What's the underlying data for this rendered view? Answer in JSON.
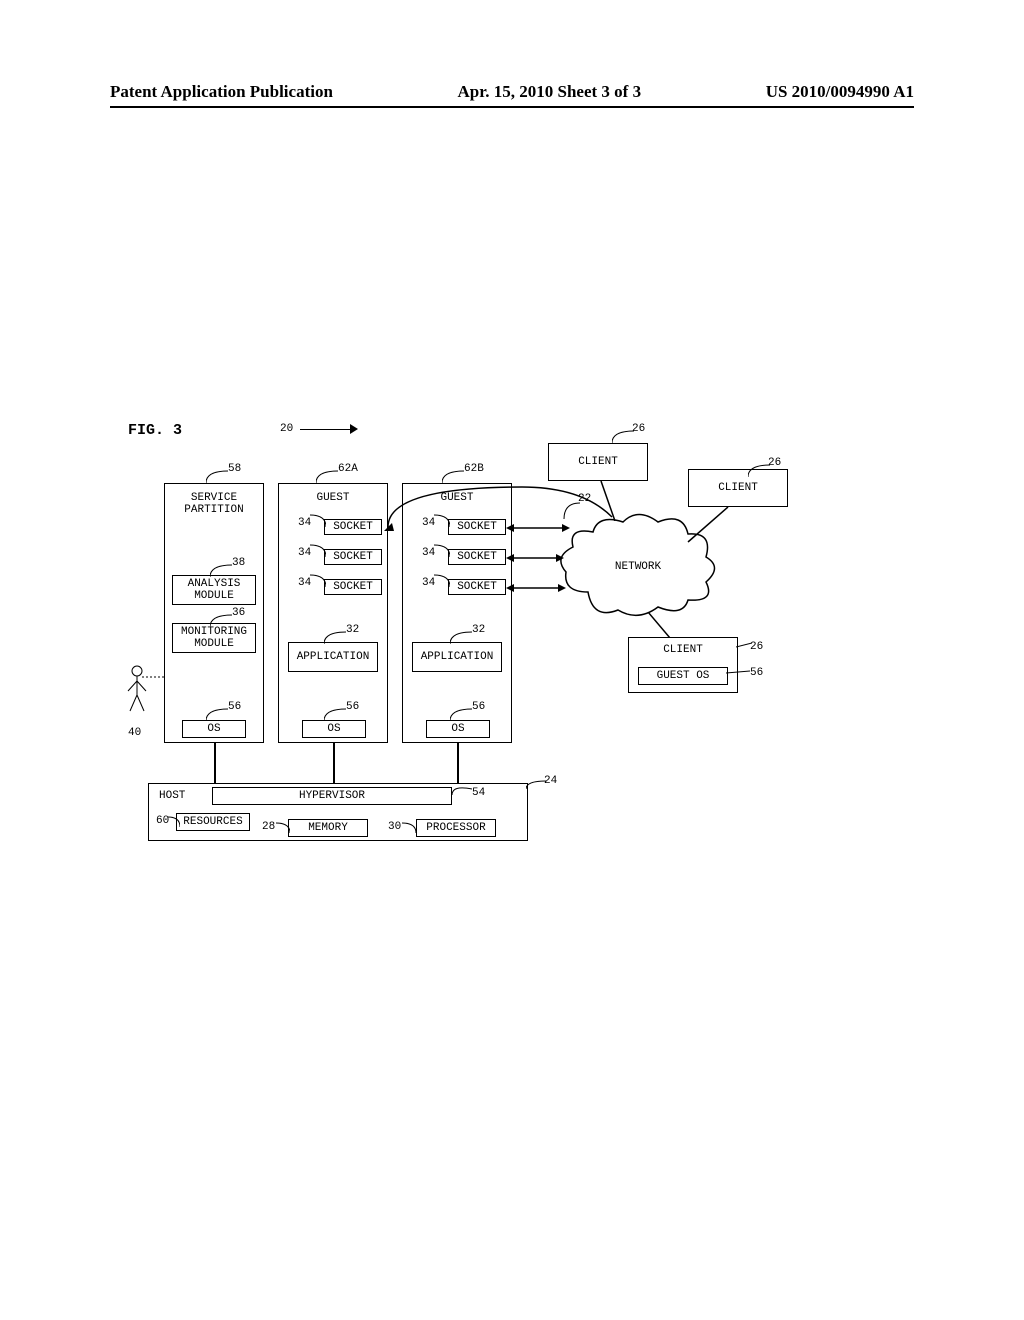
{
  "header": {
    "left": "Patent Application Publication",
    "center": "Apr. 15, 2010  Sheet 3 of 3",
    "right": "US 2010/0094990 A1"
  },
  "figure": {
    "title": "FIG. 3",
    "ref_20": "20",
    "ref_22": "22",
    "ref_24": "24",
    "ref_26": "26",
    "ref_28": "28",
    "ref_30": "30",
    "ref_32_a": "32",
    "ref_32_b": "32",
    "ref_34": "34",
    "ref_36": "36",
    "ref_38": "38",
    "ref_40": "40",
    "ref_54": "54",
    "ref_56_sp": "56",
    "ref_56_ga": "56",
    "ref_56_gb": "56",
    "ref_56_cl": "56",
    "ref_58": "58",
    "ref_60": "60",
    "ref_62a": "62A",
    "ref_62b": "62B",
    "service_partition": "SERVICE\nPARTITION",
    "guest": "GUEST",
    "socket": "SOCKET",
    "analysis_module": "ANALYSIS\nMODULE",
    "monitoring_module": "MONITORING\nMODULE",
    "application": "APPLICATION",
    "os": "OS",
    "host": "HOST",
    "hypervisor": "HYPERVISOR",
    "resources": "RESOURCES",
    "memory": "MEMORY",
    "processor": "PROCESSOR",
    "client": "CLIENT",
    "guest_os": "GUEST OS",
    "network": "NETWORK"
  }
}
